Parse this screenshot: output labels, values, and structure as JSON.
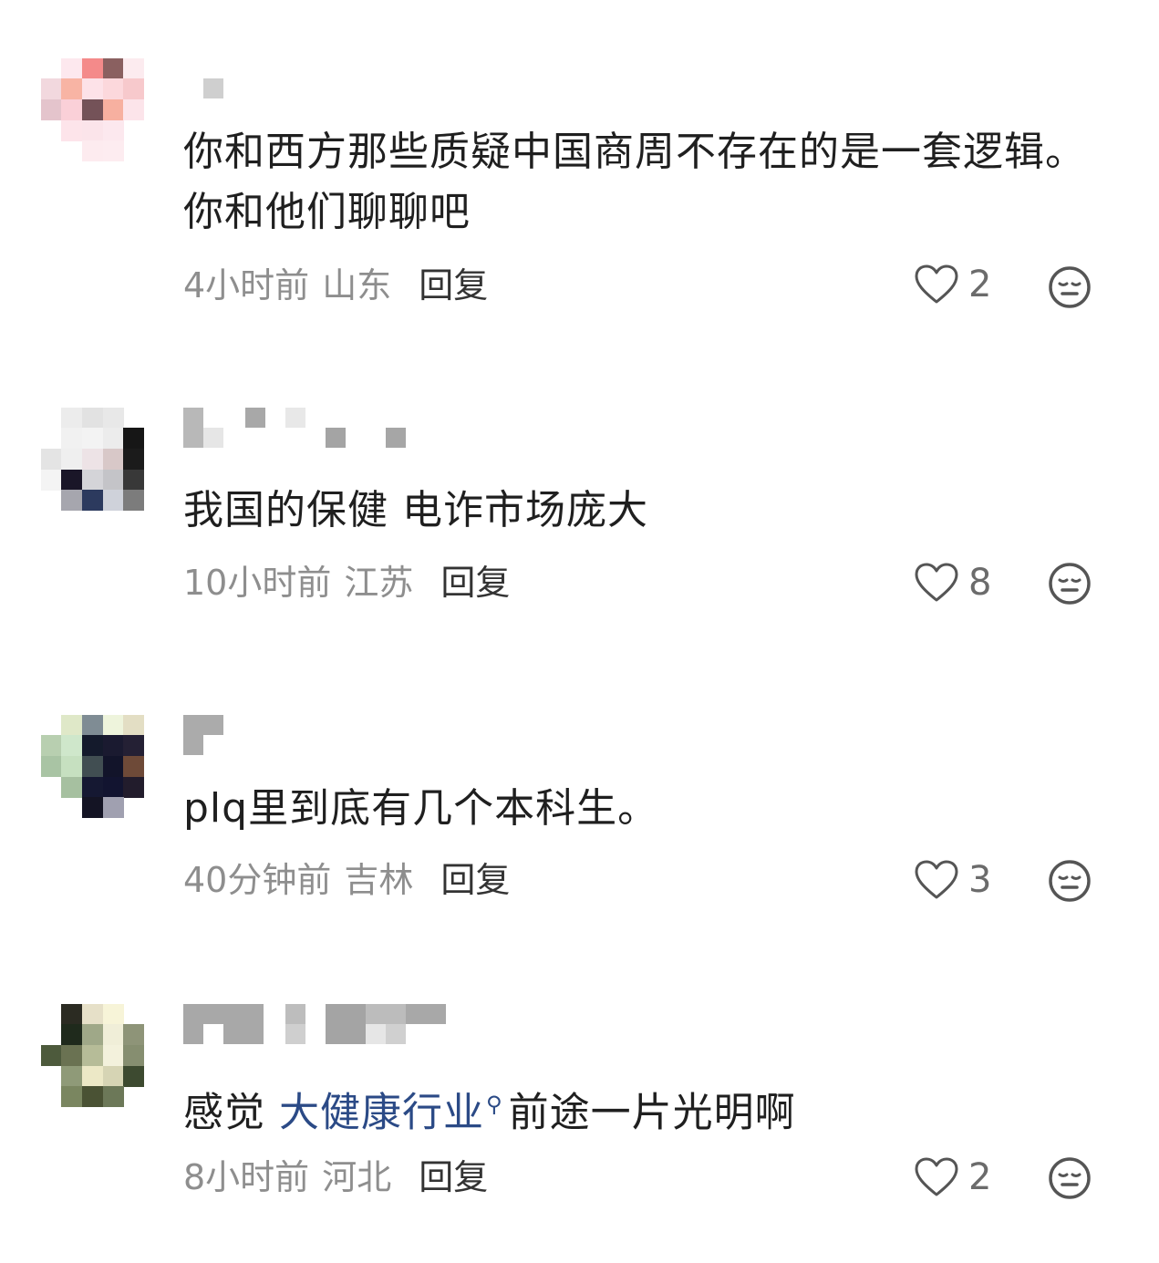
{
  "comments": [
    {
      "text": "你和西方那些质疑中国商周不存在的是一套逻辑。你和他们聊聊吧",
      "time": "4小时前",
      "location": "山东",
      "reply": "回复",
      "likes": "2"
    },
    {
      "text": "我国的保健 电诈市场庞大",
      "time": "10小时前",
      "location": "江苏",
      "reply": "回复",
      "likes": "8"
    },
    {
      "text": "plq里到底有几个本科生。",
      "time": "40分钟前",
      "location": "吉林",
      "reply": "回复",
      "likes": "3"
    },
    {
      "text_before": "感觉 ",
      "link": "大健康行业",
      "text_after": "前途一片光明啊",
      "time": "8小时前",
      "location": "河北",
      "reply": "回复",
      "likes": "2"
    }
  ],
  "icons": {
    "like": "heart-outline-icon",
    "dislike": "neutral-face-icon"
  },
  "colors": {
    "meta": "#8e8e8e",
    "link": "#2b4a86",
    "text": "#1f1f1f"
  }
}
